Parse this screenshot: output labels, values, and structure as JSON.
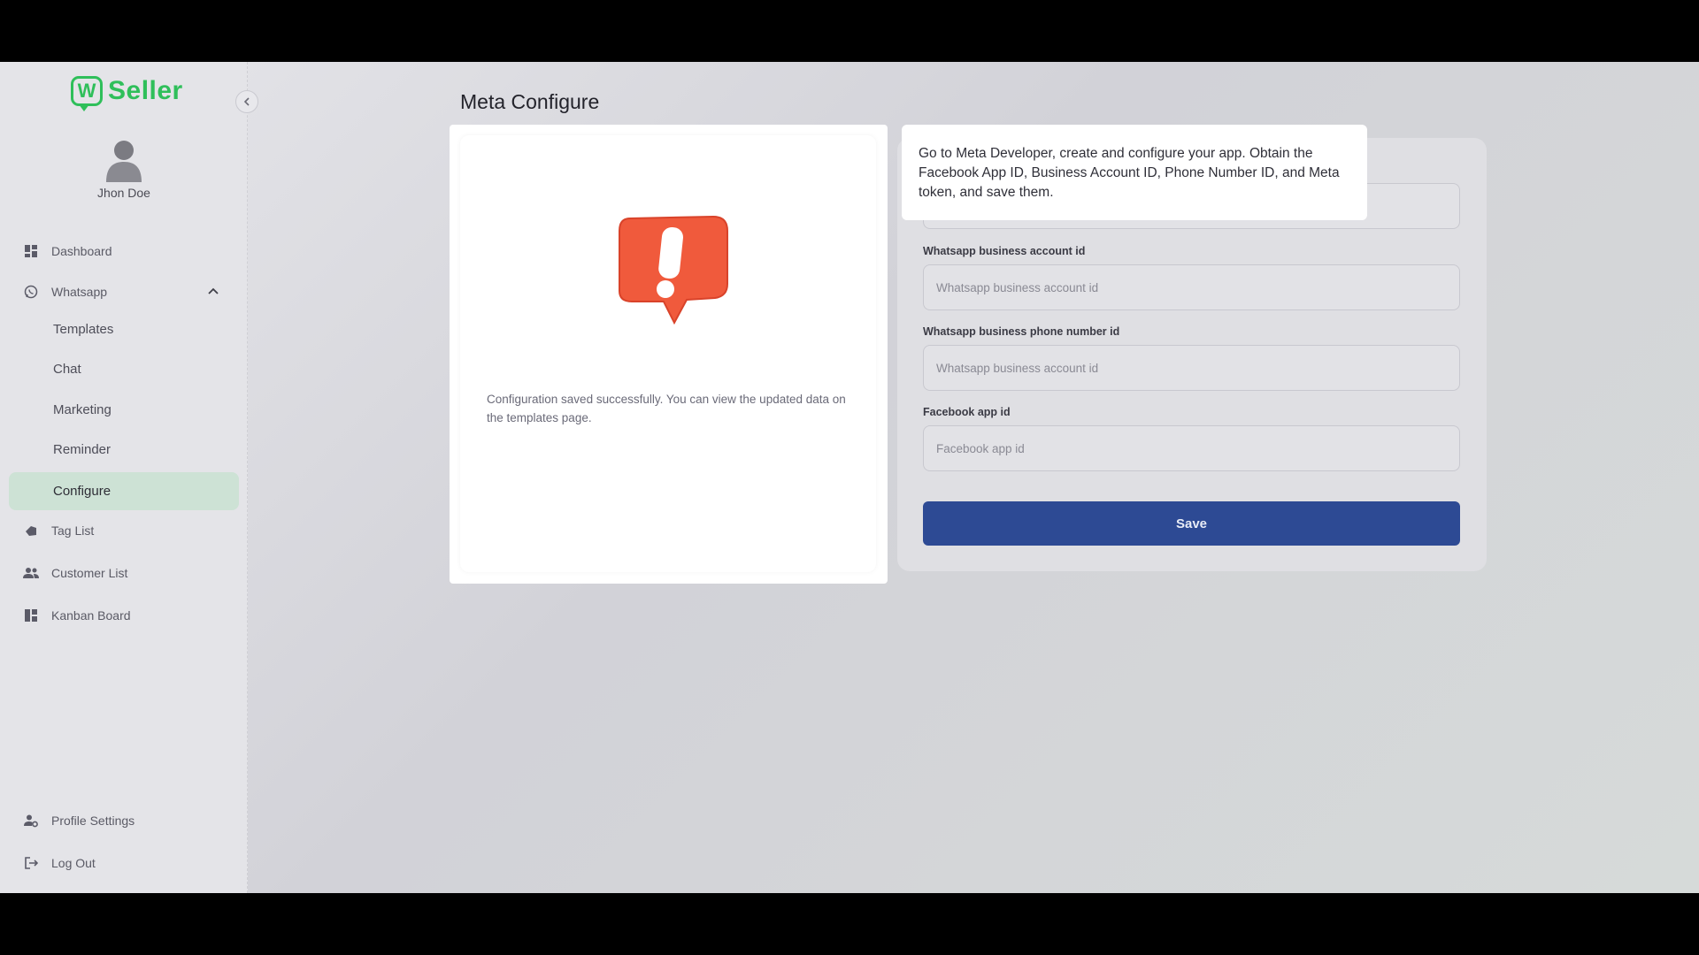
{
  "brand": {
    "logo_letter": "W",
    "name": "Seller"
  },
  "user": {
    "name": "Jhon Doe"
  },
  "sidebar": {
    "items": [
      {
        "label": "Dashboard",
        "icon": "dashboard-icon"
      },
      {
        "label": "Whatsapp",
        "icon": "whatsapp-icon"
      },
      {
        "label": "Templates"
      },
      {
        "label": "Chat"
      },
      {
        "label": "Marketing"
      },
      {
        "label": "Reminder"
      },
      {
        "label": "Configure",
        "active": true
      },
      {
        "label": "Tag List",
        "icon": "tag-icon"
      },
      {
        "label": "Customer List",
        "icon": "people-icon"
      },
      {
        "label": "Kanban Board",
        "icon": "kanban-icon"
      },
      {
        "label": "Profile Settings",
        "icon": "profile-settings-icon"
      },
      {
        "label": "Log Out",
        "icon": "logout-icon"
      }
    ]
  },
  "page": {
    "title": "Meta Configure"
  },
  "result": {
    "message": "Configuration saved successfully. You can view the updated data on the templates page.",
    "icon": "alert-icon"
  },
  "tooltip": {
    "text": "Go to Meta Developer, create and configure your app. Obtain the Facebook App ID, Business Account ID, Phone Number ID, and Meta token, and save them."
  },
  "form": {
    "fields": [
      {
        "label": "",
        "placeholder": ""
      },
      {
        "label": "Whatsapp business account id",
        "placeholder": "Whatsapp business account id"
      },
      {
        "label": "Whatsapp business phone number id",
        "placeholder": "Whatsapp business account id"
      },
      {
        "label": "Facebook app id",
        "placeholder": "Facebook app id"
      }
    ],
    "save_label": "Save"
  },
  "colors": {
    "brand_green": "#2fbf5a",
    "primary_button": "#2d4a94",
    "active_nav": "#cde2d5",
    "alert_red": "#f05a3c"
  }
}
